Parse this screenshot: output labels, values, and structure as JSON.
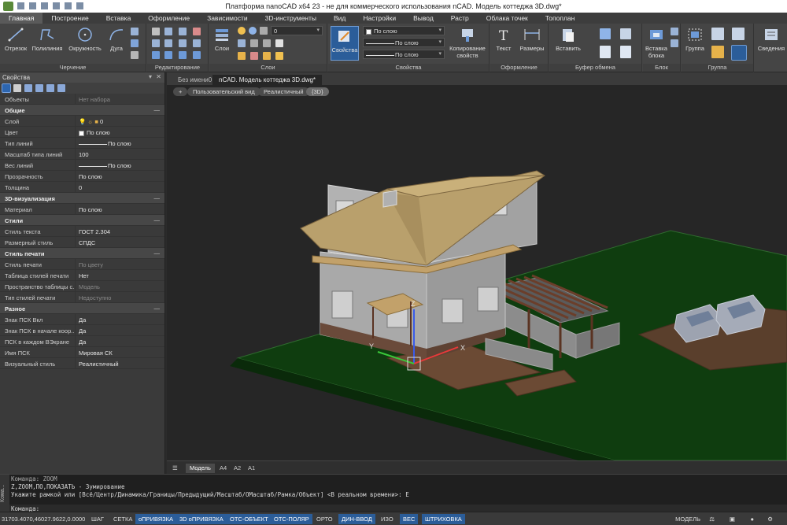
{
  "window": {
    "title": "Платформа nanoCAD x64 23 - не для коммерческого использования nCAD. Модель коттеджа 3D.dwg*"
  },
  "menu": [
    "Главная",
    "Построение",
    "Вставка",
    "Оформление",
    "Зависимости",
    "3D-инструменты",
    "Вид",
    "Настройки",
    "Вывод",
    "Растр",
    "Облака точек",
    "Топоплан"
  ],
  "ribbon": {
    "draw": {
      "label": "Черчение",
      "buttons": [
        "Отрезок",
        "Полилиния",
        "Окружность",
        "Дуга"
      ]
    },
    "edit": {
      "label": "Редактирование"
    },
    "layers": {
      "label": "Слои",
      "button": "Слои",
      "layer_value": "0"
    },
    "properties": {
      "label": "Свойства",
      "button": "Свойства",
      "copy": "Копирование свойств",
      "color": "По слою",
      "linetype": "По слою",
      "lineweight": "По слою"
    },
    "annotation": {
      "label": "Оформление",
      "text": "Текст",
      "dims": "Размеры"
    },
    "clipboard": {
      "label": "Буфер обмена",
      "paste": "Вставить"
    },
    "block": {
      "label": "Блок",
      "insert": "Вставка блока"
    },
    "group": {
      "label": "Группа",
      "group": "Группа"
    },
    "info": {
      "label": "Сведения"
    }
  },
  "properties_panel": {
    "title": "Свойства",
    "objects_key": "Объекты",
    "objects_val": "Нет набора",
    "sections": [
      {
        "name": "Общие",
        "rows": [
          {
            "k": "Слой",
            "v": "0",
            "kind": "layer"
          },
          {
            "k": "Цвет",
            "v": "По слою",
            "kind": "swatch"
          },
          {
            "k": "Тип линий",
            "v": "По слою",
            "kind": "line"
          },
          {
            "k": "Масштаб типа линий",
            "v": "100"
          },
          {
            "k": "Вес линий",
            "v": "По слою",
            "kind": "line"
          },
          {
            "k": "Прозрачность",
            "v": "По слою"
          },
          {
            "k": "Толщина",
            "v": "0"
          }
        ]
      },
      {
        "name": "3D-визуализация",
        "rows": [
          {
            "k": "Материал",
            "v": "По слою"
          }
        ]
      },
      {
        "name": "Стили",
        "rows": [
          {
            "k": "Стиль текста",
            "v": "ГОСТ 2.304"
          },
          {
            "k": "Размерный стиль",
            "v": "СПДС"
          }
        ]
      },
      {
        "name": "Стиль печати",
        "rows": [
          {
            "k": "Стиль печати",
            "v": "По цвету",
            "dim": true
          },
          {
            "k": "Таблица стилей печати",
            "v": "Нет"
          },
          {
            "k": "Пространство таблицы с...",
            "v": "Модель",
            "dim": true
          },
          {
            "k": "Тип стилей печати",
            "v": "Недоступно",
            "dim": true
          }
        ]
      },
      {
        "name": "Разное",
        "rows": [
          {
            "k": "Знак ПСК Вкл",
            "v": "Да"
          },
          {
            "k": "Знак ПСК в начале коор...",
            "v": "Да"
          },
          {
            "k": "ПСК в каждом ВЭкране",
            "v": "Да"
          },
          {
            "k": "Имя ПСК",
            "v": "Мировая СК"
          },
          {
            "k": "Визуальный стиль",
            "v": "Реалистичный"
          }
        ]
      }
    ]
  },
  "doc_tabs": [
    "Без имени0",
    "nCAD. Модель коттеджа 3D.dwg*"
  ],
  "viewport_controls": [
    "+",
    "Пользовательский вид",
    "Реалистичный",
    "{3D}"
  ],
  "axis_labels": {
    "x": "X",
    "y": "Y",
    "z": "Z"
  },
  "layout_tabs": [
    "Модель",
    "A4",
    "A2",
    "A1"
  ],
  "command_line": {
    "side_label": "Кома...",
    "lines": [
      "Команда: ZOOM",
      "Z,ZOOM,ПО,ПОКАЗАТЬ - Зумирование",
      "Укажите рамкой или [Всё/Центр/Динамика/Границы/Предыдущий/Масштаб/ОМасштаб/Рамка/Объект] <В реальном времени>: E",
      "Команда:"
    ]
  },
  "status_bar": {
    "coords": "31703.4070,46027.9622,0.0000",
    "toggles": [
      {
        "label": "ШАГ",
        "on": false
      },
      {
        "label": "СЕТКА",
        "on": false
      },
      {
        "label": "оПРИВЯЗКА",
        "on": true
      },
      {
        "label": "3D оПРИВЯЗКА",
        "on": true
      },
      {
        "label": "ОТС-ОБЪЕКТ",
        "on": true
      },
      {
        "label": "ОТС-ПОЛЯР",
        "on": true
      },
      {
        "label": "ОРТО",
        "on": false
      },
      {
        "label": "ДИН-ВВОД",
        "on": true
      },
      {
        "label": "ИЗО",
        "on": false
      },
      {
        "label": "ВЕС",
        "on": true
      },
      {
        "label": "ШТРИХОВКА",
        "on": true
      }
    ],
    "model": "МОДЕЛЬ"
  },
  "colors": {
    "accent": "#2b5d99",
    "ground": "#0f3d0f",
    "roof": "#b9a06c",
    "walls": "#a8a8a8",
    "patio": "#6b4a34"
  }
}
